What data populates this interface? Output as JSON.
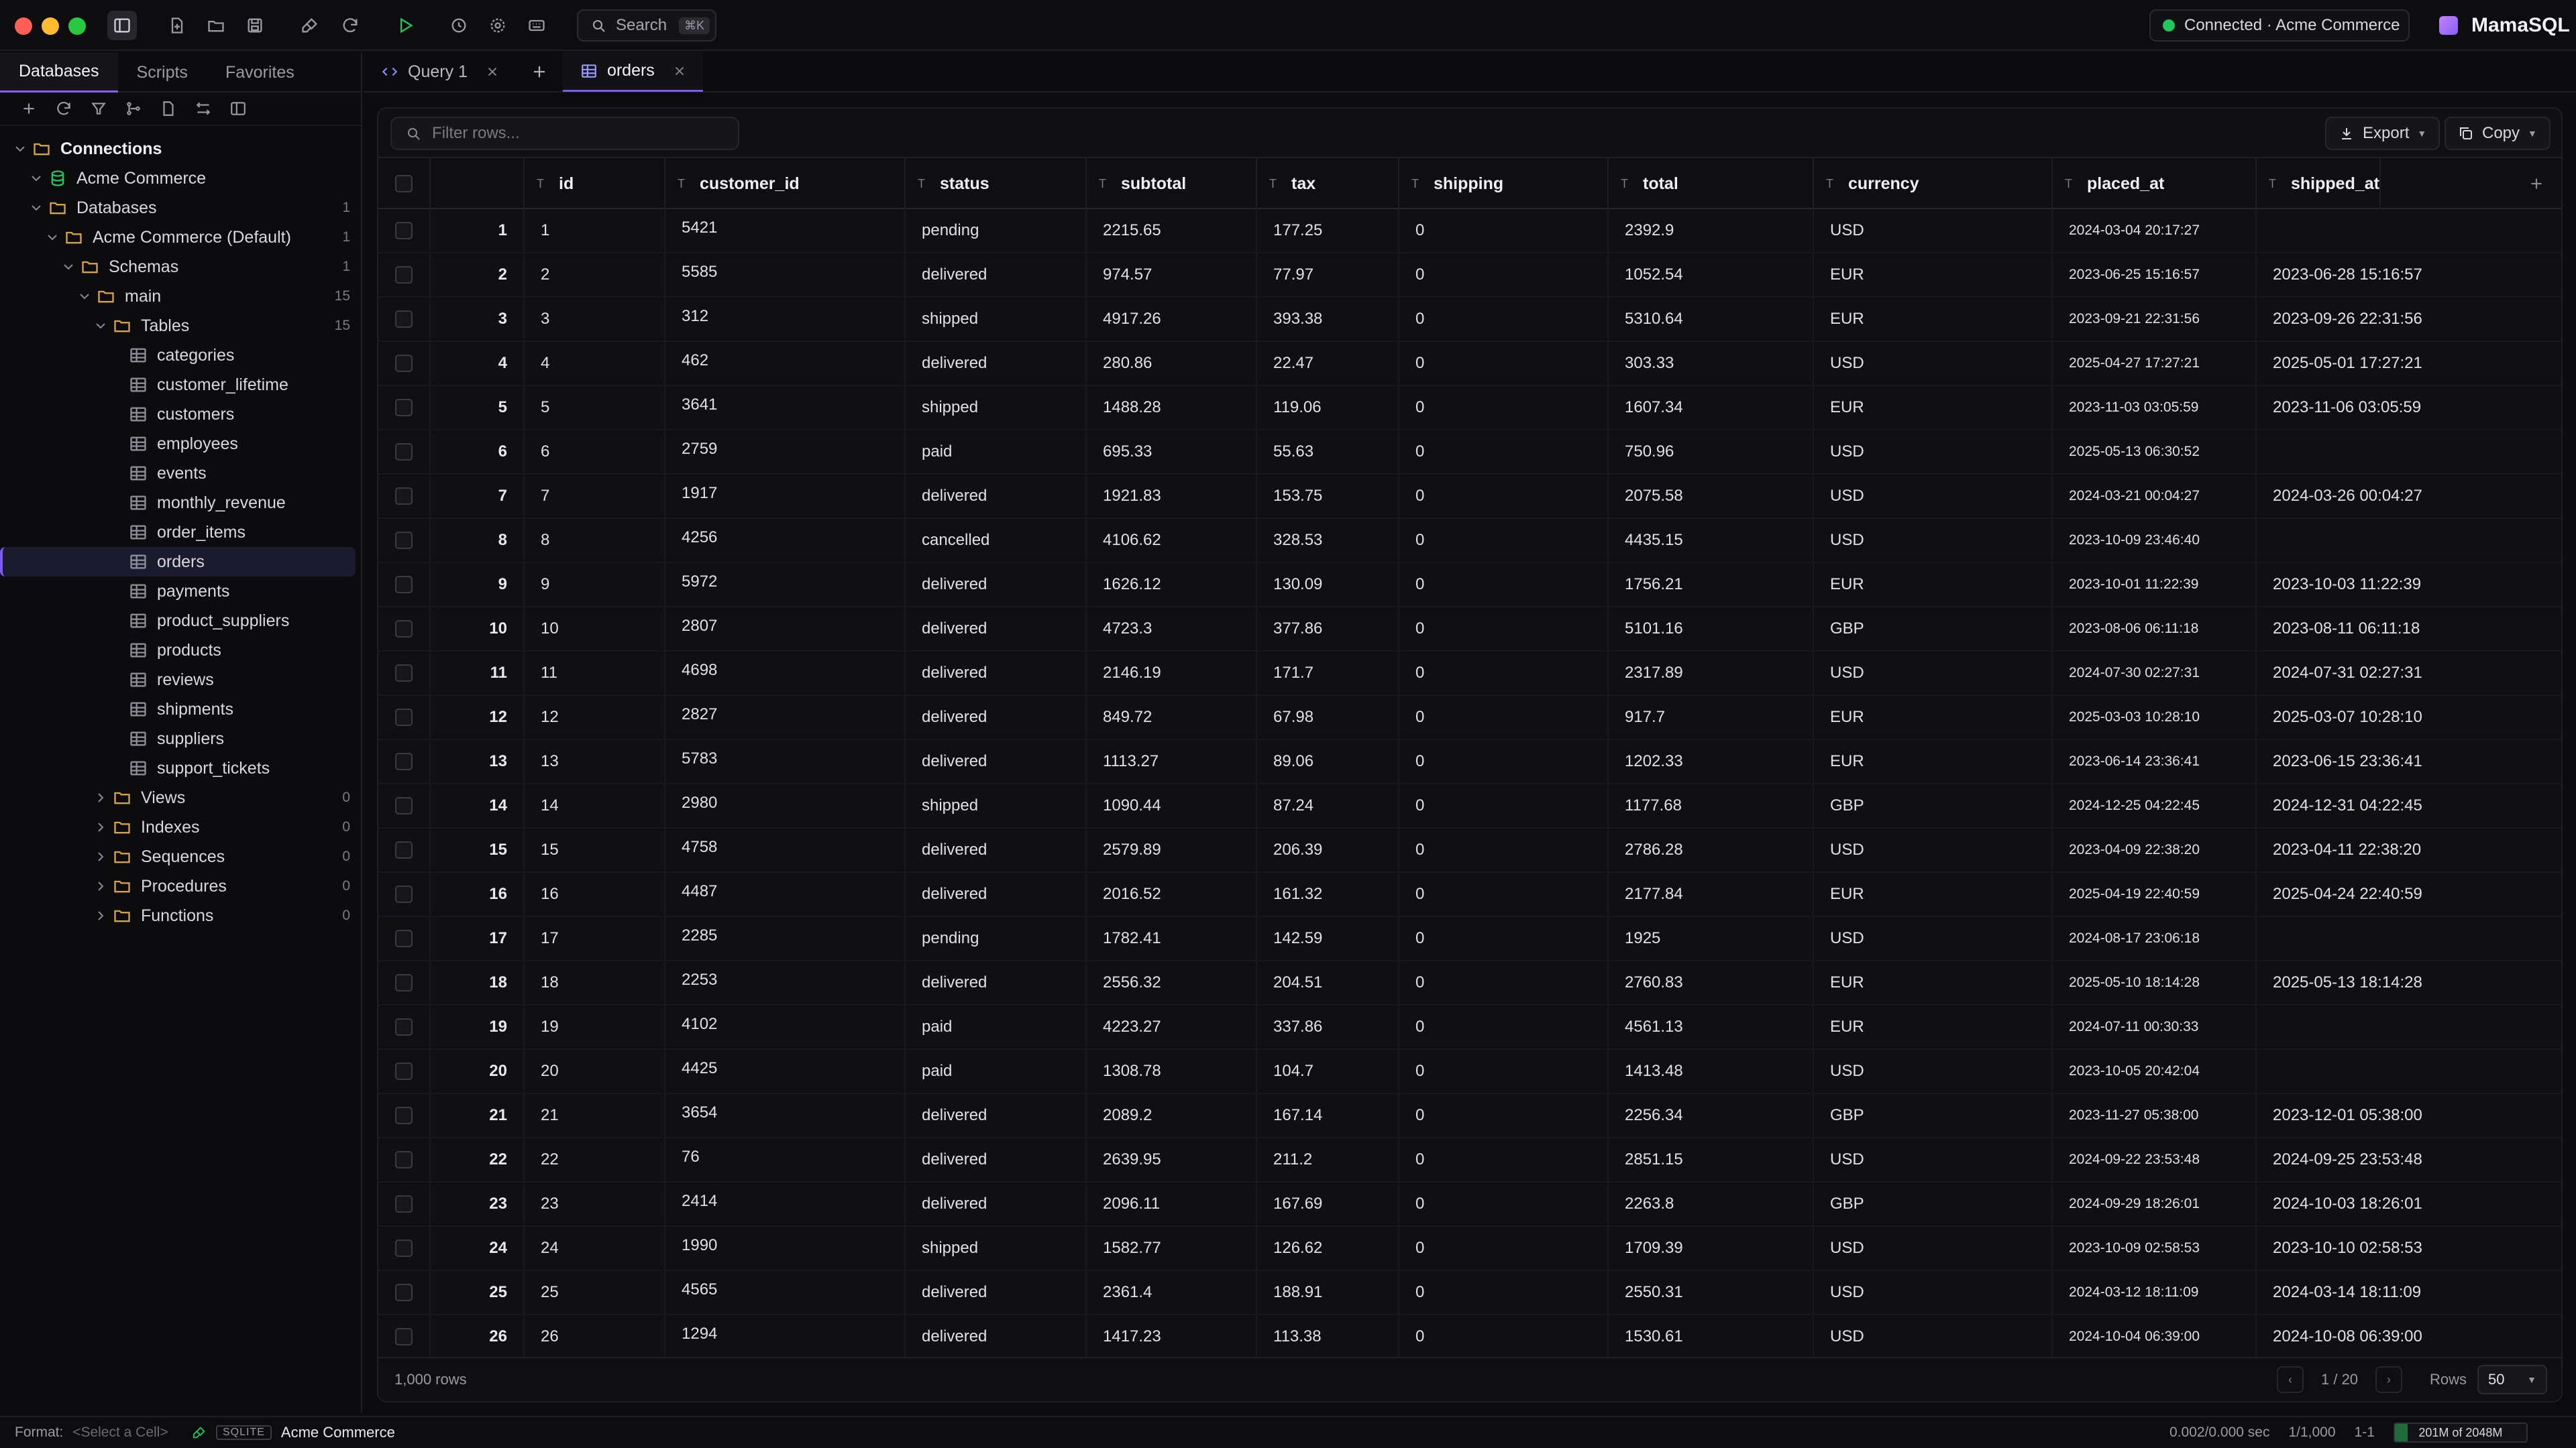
{
  "app": {
    "search_label": "Search",
    "search_shortcut": "⌘K",
    "connection_status": "Connected · Acme Commerce",
    "brand": "MamaSQL",
    "colors": {
      "accent": "#7c5cf0",
      "connected": "#22c55e",
      "folder": "#d9a441"
    }
  },
  "sidebar": {
    "tabs": [
      "Databases",
      "Scripts",
      "Favorites"
    ],
    "tree": [
      {
        "label": "Connections",
        "level": 0,
        "type": "folder",
        "expanded": true,
        "bold": true
      },
      {
        "label": "Acme Commerce",
        "level": 1,
        "type": "database",
        "expanded": true
      },
      {
        "label": "Databases",
        "level": 1,
        "type": "folder",
        "expanded": true,
        "count": "1"
      },
      {
        "label": "Acme Commerce (Default)",
        "level": 2,
        "type": "folder",
        "expanded": true,
        "count": "1"
      },
      {
        "label": "Schemas",
        "level": 3,
        "type": "folder",
        "expanded": true,
        "count": "1"
      },
      {
        "label": "main",
        "level": 4,
        "type": "folder",
        "expanded": true,
        "count": "15"
      },
      {
        "label": "Tables",
        "level": 5,
        "type": "folder",
        "expanded": true,
        "count": "15"
      },
      {
        "label": "categories",
        "level": 6,
        "type": "table"
      },
      {
        "label": "customer_lifetime",
        "level": 6,
        "type": "table"
      },
      {
        "label": "customers",
        "level": 6,
        "type": "table"
      },
      {
        "label": "employees",
        "level": 6,
        "type": "table"
      },
      {
        "label": "events",
        "level": 6,
        "type": "table"
      },
      {
        "label": "monthly_revenue",
        "level": 6,
        "type": "table"
      },
      {
        "label": "order_items",
        "level": 6,
        "type": "table"
      },
      {
        "label": "orders",
        "level": 6,
        "type": "table",
        "selected": true
      },
      {
        "label": "payments",
        "level": 6,
        "type": "table"
      },
      {
        "label": "product_suppliers",
        "level": 6,
        "type": "table"
      },
      {
        "label": "products",
        "level": 6,
        "type": "table"
      },
      {
        "label": "reviews",
        "level": 6,
        "type": "table"
      },
      {
        "label": "shipments",
        "level": 6,
        "type": "table"
      },
      {
        "label": "suppliers",
        "level": 6,
        "type": "table"
      },
      {
        "label": "support_tickets",
        "level": 6,
        "type": "table"
      },
      {
        "label": "Views",
        "level": 5,
        "type": "folder",
        "expanded": false,
        "count": "0"
      },
      {
        "label": "Indexes",
        "level": 5,
        "type": "folder",
        "expanded": false,
        "count": "0"
      },
      {
        "label": "Sequences",
        "level": 5,
        "type": "folder",
        "expanded": false,
        "count": "0"
      },
      {
        "label": "Procedures",
        "level": 5,
        "type": "folder",
        "expanded": false,
        "count": "0"
      },
      {
        "label": "Functions",
        "level": 5,
        "type": "folder",
        "expanded": false,
        "count": "0"
      }
    ]
  },
  "editor_tabs": [
    {
      "label": "Query 1",
      "icon": "code-icon",
      "active": false
    },
    {
      "label": "orders",
      "icon": "table-icon",
      "active": true
    }
  ],
  "toolbar": {
    "filter_placeholder": "Filter rows...",
    "export_label": "Export",
    "copy_label": "Copy"
  },
  "grid": {
    "type_marker": "T",
    "columns": [
      "id",
      "customer_id",
      "status",
      "subtotal",
      "tax",
      "shipping",
      "total",
      "currency",
      "placed_at",
      "shipped_at"
    ],
    "rows": [
      [
        "1",
        "1",
        "5421",
        "pending",
        "2215.65",
        "177.25",
        "0",
        "2392.9",
        "USD",
        "2024-03-04 20:17:27",
        ""
      ],
      [
        "2",
        "2",
        "5585",
        "delivered",
        "974.57",
        "77.97",
        "0",
        "1052.54",
        "EUR",
        "2023-06-25 15:16:57",
        "2023-06-28 15:16:57"
      ],
      [
        "3",
        "3",
        "312",
        "shipped",
        "4917.26",
        "393.38",
        "0",
        "5310.64",
        "EUR",
        "2023-09-21 22:31:56",
        "2023-09-26 22:31:56"
      ],
      [
        "4",
        "4",
        "462",
        "delivered",
        "280.86",
        "22.47",
        "0",
        "303.33",
        "USD",
        "2025-04-27 17:27:21",
        "2025-05-01 17:27:21"
      ],
      [
        "5",
        "5",
        "3641",
        "shipped",
        "1488.28",
        "119.06",
        "0",
        "1607.34",
        "EUR",
        "2023-11-03 03:05:59",
        "2023-11-06 03:05:59"
      ],
      [
        "6",
        "6",
        "2759",
        "paid",
        "695.33",
        "55.63",
        "0",
        "750.96",
        "USD",
        "2025-05-13 06:30:52",
        ""
      ],
      [
        "7",
        "7",
        "1917",
        "delivered",
        "1921.83",
        "153.75",
        "0",
        "2075.58",
        "USD",
        "2024-03-21 00:04:27",
        "2024-03-26 00:04:27"
      ],
      [
        "8",
        "8",
        "4256",
        "cancelled",
        "4106.62",
        "328.53",
        "0",
        "4435.15",
        "USD",
        "2023-10-09 23:46:40",
        ""
      ],
      [
        "9",
        "9",
        "5972",
        "delivered",
        "1626.12",
        "130.09",
        "0",
        "1756.21",
        "EUR",
        "2023-10-01 11:22:39",
        "2023-10-03 11:22:39"
      ],
      [
        "10",
        "10",
        "2807",
        "delivered",
        "4723.3",
        "377.86",
        "0",
        "5101.16",
        "GBP",
        "2023-08-06 06:11:18",
        "2023-08-11 06:11:18"
      ],
      [
        "11",
        "11",
        "4698",
        "delivered",
        "2146.19",
        "171.7",
        "0",
        "2317.89",
        "USD",
        "2024-07-30 02:27:31",
        "2024-07-31 02:27:31"
      ],
      [
        "12",
        "12",
        "2827",
        "delivered",
        "849.72",
        "67.98",
        "0",
        "917.7",
        "EUR",
        "2025-03-03 10:28:10",
        "2025-03-07 10:28:10"
      ],
      [
        "13",
        "13",
        "5783",
        "delivered",
        "1113.27",
        "89.06",
        "0",
        "1202.33",
        "EUR",
        "2023-06-14 23:36:41",
        "2023-06-15 23:36:41"
      ],
      [
        "14",
        "14",
        "2980",
        "shipped",
        "1090.44",
        "87.24",
        "0",
        "1177.68",
        "GBP",
        "2024-12-25 04:22:45",
        "2024-12-31 04:22:45"
      ],
      [
        "15",
        "15",
        "4758",
        "delivered",
        "2579.89",
        "206.39",
        "0",
        "2786.28",
        "USD",
        "2023-04-09 22:38:20",
        "2023-04-11 22:38:20"
      ],
      [
        "16",
        "16",
        "4487",
        "delivered",
        "2016.52",
        "161.32",
        "0",
        "2177.84",
        "EUR",
        "2025-04-19 22:40:59",
        "2025-04-24 22:40:59"
      ],
      [
        "17",
        "17",
        "2285",
        "pending",
        "1782.41",
        "142.59",
        "0",
        "1925",
        "USD",
        "2024-08-17 23:06:18",
        ""
      ],
      [
        "18",
        "18",
        "2253",
        "delivered",
        "2556.32",
        "204.51",
        "0",
        "2760.83",
        "EUR",
        "2025-05-10 18:14:28",
        "2025-05-13 18:14:28"
      ],
      [
        "19",
        "19",
        "4102",
        "paid",
        "4223.27",
        "337.86",
        "0",
        "4561.13",
        "EUR",
        "2024-07-11 00:30:33",
        ""
      ],
      [
        "20",
        "20",
        "4425",
        "paid",
        "1308.78",
        "104.7",
        "0",
        "1413.48",
        "USD",
        "2023-10-05 20:42:04",
        ""
      ],
      [
        "21",
        "21",
        "3654",
        "delivered",
        "2089.2",
        "167.14",
        "0",
        "2256.34",
        "GBP",
        "2023-11-27 05:38:00",
        "2023-12-01 05:38:00"
      ],
      [
        "22",
        "22",
        "76",
        "delivered",
        "2639.95",
        "211.2",
        "0",
        "2851.15",
        "USD",
        "2024-09-22 23:53:48",
        "2024-09-25 23:53:48"
      ],
      [
        "23",
        "23",
        "2414",
        "delivered",
        "2096.11",
        "167.69",
        "0",
        "2263.8",
        "GBP",
        "2024-09-29 18:26:01",
        "2024-10-03 18:26:01"
      ],
      [
        "24",
        "24",
        "1990",
        "shipped",
        "1582.77",
        "126.62",
        "0",
        "1709.39",
        "USD",
        "2023-10-09 02:58:53",
        "2023-10-10 02:58:53"
      ],
      [
        "25",
        "25",
        "4565",
        "delivered",
        "2361.4",
        "188.91",
        "0",
        "2550.31",
        "USD",
        "2024-03-12 18:11:09",
        "2024-03-14 18:11:09"
      ],
      [
        "26",
        "26",
        "1294",
        "delivered",
        "1417.23",
        "113.38",
        "0",
        "1530.61",
        "USD",
        "2024-10-04 06:39:00",
        "2024-10-08 06:39:00"
      ]
    ]
  },
  "footer": {
    "row_count": "1,000 rows",
    "page": "1 / 20",
    "rows_label": "Rows",
    "rows_per_page": "50"
  },
  "statusbar": {
    "format_label": "Format:",
    "format_value": "<Select a Cell>",
    "db_badge": "SQLITE",
    "connection": "Acme Commerce",
    "timing": "0.002/0.000 sec",
    "rows_info": "1/1,000",
    "cursor": "1-1",
    "memory": "201M of 2048M",
    "memory_used_fraction": 0.098
  }
}
